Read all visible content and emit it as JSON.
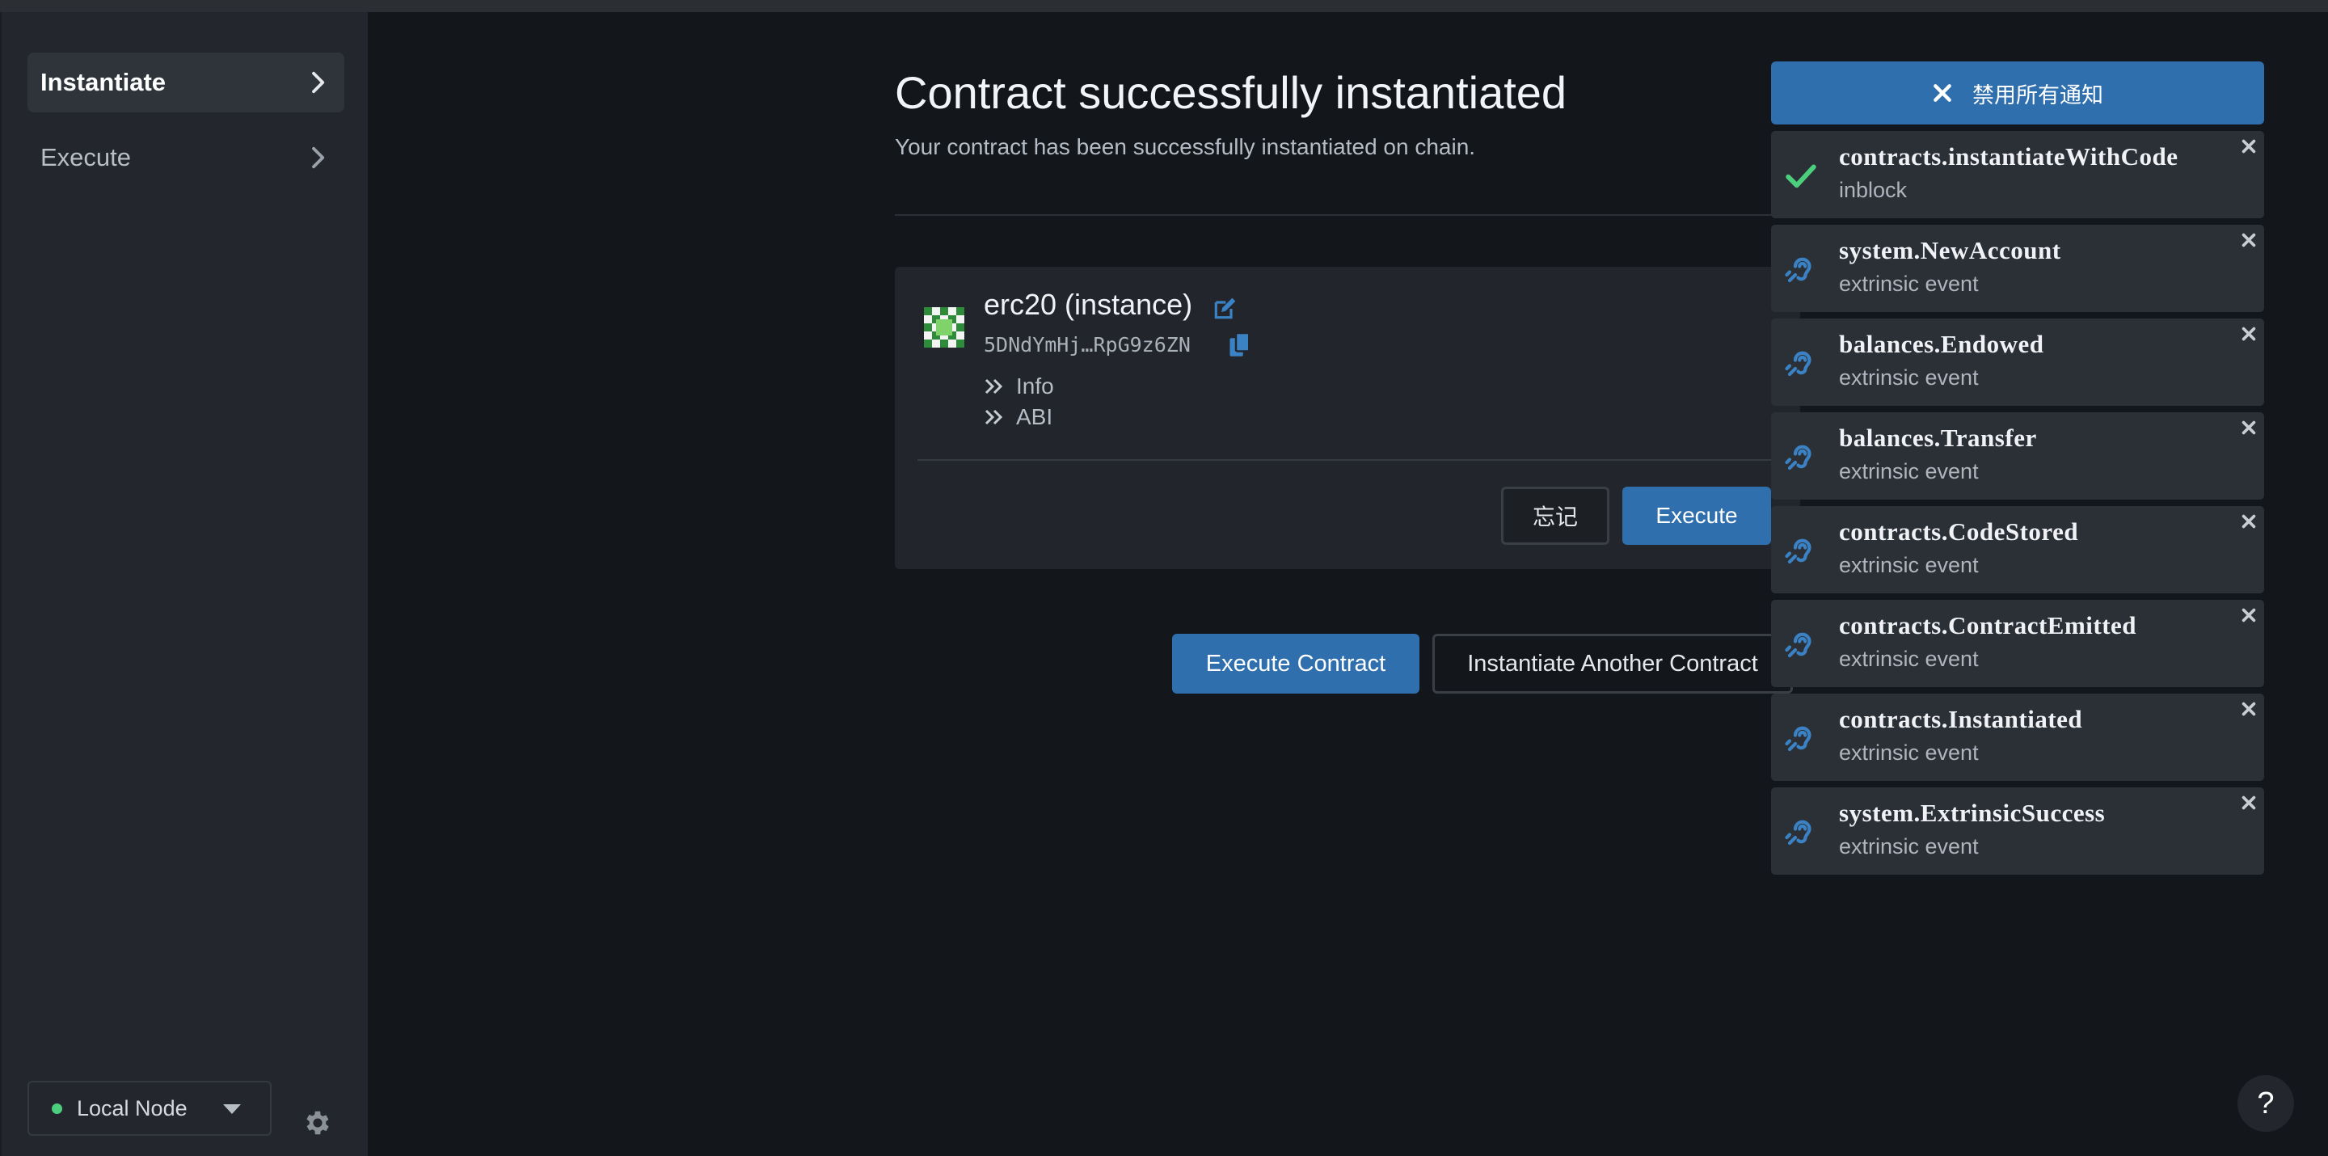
{
  "sidebar": {
    "items": [
      {
        "label": "Instantiate",
        "active": true
      },
      {
        "label": "Execute",
        "active": false
      }
    ],
    "node": {
      "label": "Local Node",
      "status_color": "#4ccf7c"
    }
  },
  "main": {
    "title": "Contract successfully instantiated",
    "subtitle": "Your contract has been successfully instantiated on chain.",
    "contract": {
      "name": "erc20 (instance)",
      "address": "5DNdYmHj…RpG9z6ZN",
      "sections": [
        "Info",
        "ABI"
      ],
      "forget_label": "忘记",
      "execute_label": "Execute"
    },
    "actions": {
      "execute_contract": "Execute Contract",
      "instantiate_another": "Instantiate Another Contract"
    }
  },
  "notifications": {
    "dismiss_all_label": "禁用所有通知",
    "items": [
      {
        "title": "contracts.instantiateWithCode",
        "subtitle": "inblock",
        "icon": "check-icon"
      },
      {
        "title": "system.NewAccount",
        "subtitle": "extrinsic event",
        "icon": "assistive-listening-icon"
      },
      {
        "title": "balances.Endowed",
        "subtitle": "extrinsic event",
        "icon": "assistive-listening-icon"
      },
      {
        "title": "balances.Transfer",
        "subtitle": "extrinsic event",
        "icon": "assistive-listening-icon"
      },
      {
        "title": "contracts.CodeStored",
        "subtitle": "extrinsic event",
        "icon": "assistive-listening-icon"
      },
      {
        "title": "contracts.ContractEmitted",
        "subtitle": "extrinsic event",
        "icon": "assistive-listening-icon"
      },
      {
        "title": "contracts.Instantiated",
        "subtitle": "extrinsic event",
        "icon": "assistive-listening-icon"
      },
      {
        "title": "system.ExtrinsicSuccess",
        "subtitle": "extrinsic event",
        "icon": "assistive-listening-icon"
      }
    ]
  },
  "help": {
    "label": "?"
  },
  "colors": {
    "accent": "#2f6fad",
    "success": "#4ccf7c",
    "background": "#13161b",
    "sidebar": "#23272d"
  }
}
